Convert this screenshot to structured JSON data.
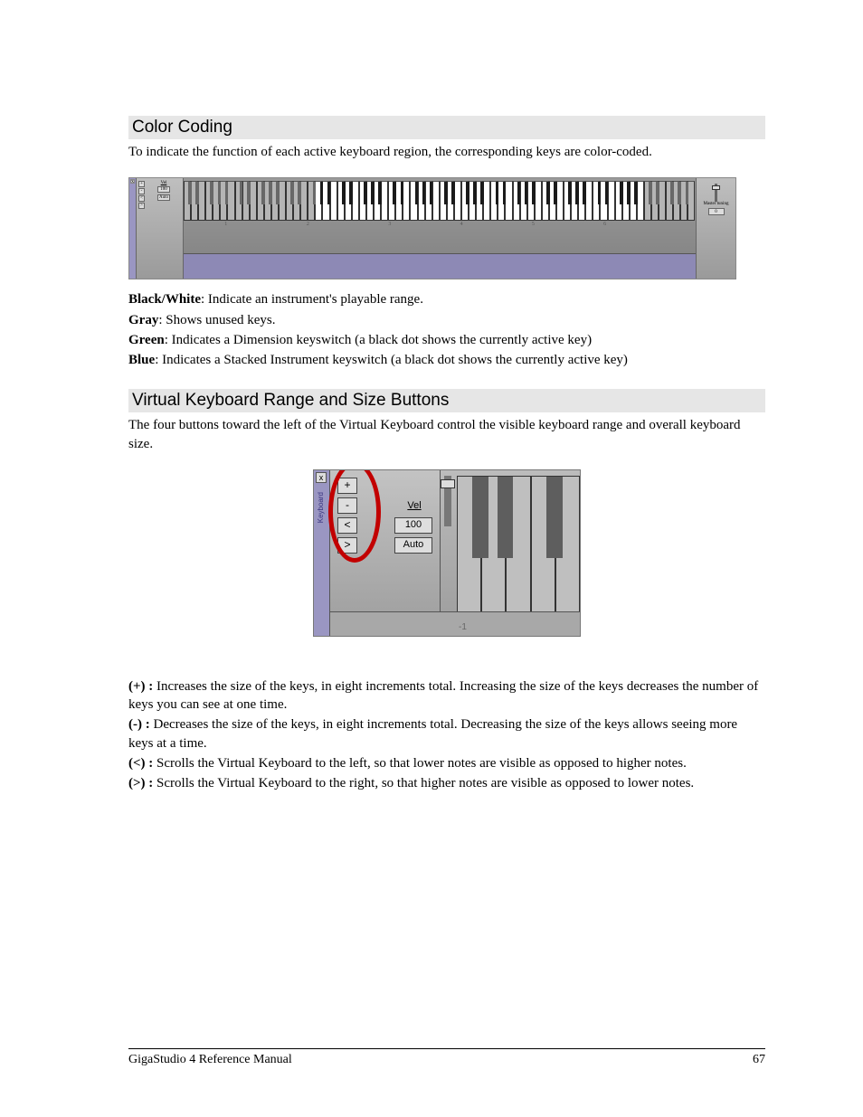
{
  "section1": {
    "title": "Color Coding",
    "intro": "To indicate the function of each active keyboard region, the corresponding keys are color-coded.",
    "defs": [
      {
        "term": "Black/White",
        "desc": ": Indicate an instrument's playable range."
      },
      {
        "term": "Gray",
        "desc": ": Shows unused keys."
      },
      {
        "term": "Green",
        "desc": ": Indicates a Dimension keyswitch (a black dot shows the currently active key)"
      },
      {
        "term": "Blue",
        "desc": ": Indicates a Stacked Instrument keyswitch (a black dot shows the currently active key)"
      }
    ]
  },
  "fig1": {
    "sidebar_x": "x",
    "vel_label": "Vel",
    "vel_value": "100",
    "auto": "Auto",
    "btns": [
      "+",
      "-",
      "<",
      ">"
    ],
    "octaves": [
      "1",
      "2",
      "3",
      "4",
      "5",
      "6"
    ],
    "master_label": "Master tuning",
    "master_value": "0"
  },
  "section2": {
    "title": "Virtual Keyboard Range and Size Buttons",
    "intro": "The four buttons toward the left of the Virtual Keyboard control the visible keyboard range and overall keyboard size.",
    "defs": [
      {
        "term": "(+) :",
        "desc": " Increases the size of the keys, in eight increments total. Increasing the size of the keys decreases the number of keys you can see at one time."
      },
      {
        "term": "(-) :",
        "desc": " Decreases the size of the keys, in eight increments total. Decreasing the size of the keys allows seeing more keys at a time."
      },
      {
        "term": "(<) :",
        "desc": " Scrolls the Virtual Keyboard to the left, so that lower notes are visible as opposed to higher notes."
      },
      {
        "term": "(>) :",
        "desc": " Scrolls the Virtual Keyboard to the right, so that higher notes are visible as opposed to lower notes."
      }
    ]
  },
  "fig2": {
    "x": "x",
    "vtab": "Keyboard",
    "btns": [
      "+",
      "-",
      "<",
      ">"
    ],
    "vel_label": "Vel",
    "vel_value": "100",
    "auto": "Auto",
    "octave": "-1"
  },
  "footer": {
    "left": "GigaStudio 4 Reference Manual",
    "right": "67"
  }
}
